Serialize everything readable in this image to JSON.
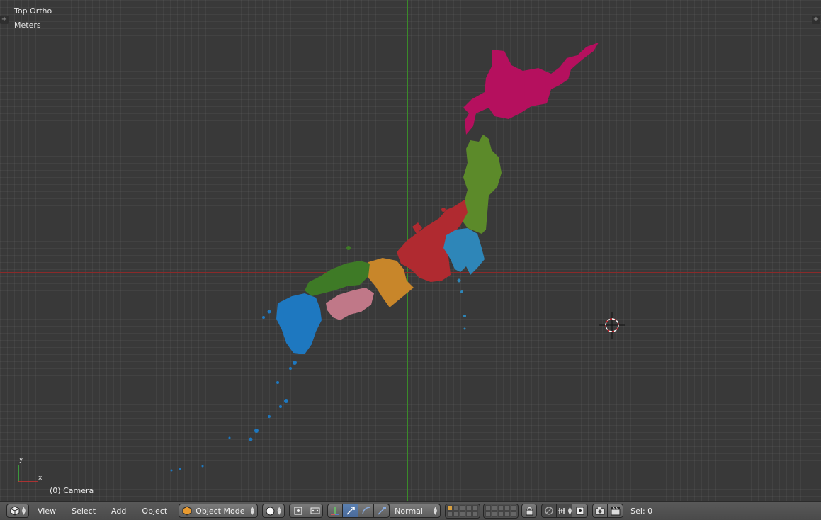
{
  "viewport": {
    "view_name": "Top Ortho",
    "units": "Meters",
    "object_info": "(0) Camera",
    "axis_widget": {
      "y_label": "y",
      "x_label": "x"
    },
    "colors": {
      "background": "#393939",
      "x_axis": "#8a2a2a",
      "y_axis": "#3a8a2a",
      "hokkaido": "#b5105e",
      "tohoku": "#5c8a2a",
      "chubu": "#b02a30",
      "kanto": "#2e86b8",
      "kinki": "#c8862a",
      "chugoku": "#3e7a26",
      "shikoku": "#c07888",
      "kyushu": "#1e78c0"
    }
  },
  "header": {
    "editor_type_icon": "cube-icon",
    "menus": [
      "View",
      "Select",
      "Add",
      "Object"
    ],
    "mode": "Object Mode",
    "shading_icon": "solid-sphere-icon",
    "pivot_icon": "pivot-icon",
    "transform_orientation": "Normal",
    "selection_status": "Sel: 0"
  }
}
